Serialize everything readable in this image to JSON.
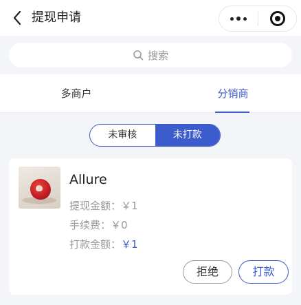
{
  "nav": {
    "title": "提现申请"
  },
  "search": {
    "placeholder": "搜索"
  },
  "tabs": [
    {
      "label": "多商户"
    },
    {
      "label": "分销商"
    }
  ],
  "segment": {
    "options": [
      "未审核",
      "未打款"
    ],
    "active": "未打款"
  },
  "card": {
    "name": "Allure",
    "withdraw_label": "提现金额：",
    "withdraw_value": "￥1",
    "fee_label": "手续费：",
    "fee_value": "￥0",
    "payment_label": "打款金额：",
    "payment_value": "￥1",
    "reject_label": "拒绝",
    "pay_label": "打款"
  },
  "colors": {
    "accent": "#3c5bcd",
    "background": "#f4f5f8"
  }
}
